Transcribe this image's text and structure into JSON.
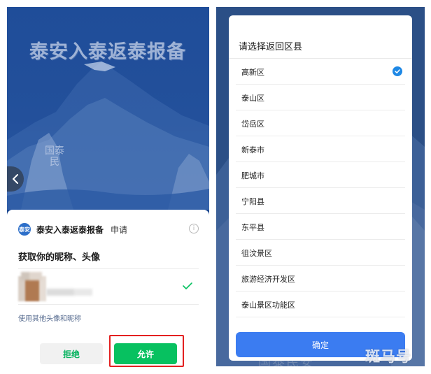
{
  "left": {
    "banner": {
      "title": "泰安入泰返泰报备",
      "stamp_text": "国泰民",
      "back_icon": "chevron-left-icon"
    },
    "auth_sheet": {
      "app_name": "泰安入泰返泰报备",
      "app_apply": "申请",
      "logo_text": "泰安",
      "info_icon_glyph": "i",
      "permission_title": "获取你的昵称、头像",
      "other_profile_link": "使用其他头像和昵称",
      "refuse_label": "拒绝",
      "allow_label": "允许"
    },
    "colors": {
      "wechat_green": "#07c160",
      "highlight_red": "#e32020"
    }
  },
  "right": {
    "dialog": {
      "title": "请选择返回区县",
      "districts": [
        {
          "label": "高新区",
          "selected": true
        },
        {
          "label": "泰山区",
          "selected": false
        },
        {
          "label": "岱岳区",
          "selected": false
        },
        {
          "label": "新泰市",
          "selected": false
        },
        {
          "label": "肥城市",
          "selected": false
        },
        {
          "label": "宁阳县",
          "selected": false
        },
        {
          "label": "东平县",
          "selected": false
        },
        {
          "label": "徂汶景区",
          "selected": false
        },
        {
          "label": "旅游经济开发区",
          "selected": false
        },
        {
          "label": "泰山景区功能区",
          "selected": false
        }
      ],
      "confirm_label": "确定"
    },
    "background_text": "国泰民安",
    "colors": {
      "accent_blue": "#3b7cf1"
    }
  },
  "watermark": "斑马号"
}
